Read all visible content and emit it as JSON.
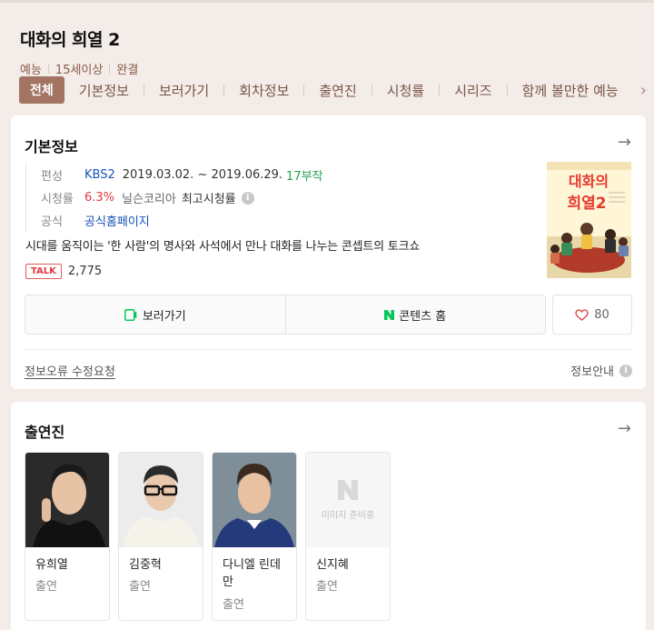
{
  "header": {
    "title": "대화의 희열 2",
    "meta": [
      "예능",
      "15세이상",
      "완결"
    ]
  },
  "tabs": [
    {
      "label": "전체",
      "active": true
    },
    {
      "label": "기본정보"
    },
    {
      "label": "보러가기"
    },
    {
      "label": "회차정보"
    },
    {
      "label": "출연진"
    },
    {
      "label": "시청률"
    },
    {
      "label": "시리즈"
    },
    {
      "label": "함께 볼만한 예능"
    }
  ],
  "basic_info": {
    "section_title": "기본정보",
    "schedule_label": "편성",
    "channel": "KBS2",
    "date_range": "2019.03.02. ~ 2019.06.29.",
    "episodes": "17부작",
    "rating_label": "시청률",
    "rating_value": "6.3%",
    "rating_source": "닐슨코리아",
    "rating_note": "최고시청률",
    "official_label": "공식",
    "official_link": "공식홈페이지",
    "description": "시대를 움직이는 '한 사람'의 명사와 사석에서 만나 대화를 나누는 콘셉트의 토크쇼",
    "talk_badge": "TALK",
    "talk_count": "2,775",
    "watch_button": "보러가기",
    "content_home_button": "콘텐츠 홈",
    "like_count": "80",
    "report_link": "정보오류 수정요청",
    "info_guide": "정보안내",
    "poster_text_line1": "대화의",
    "poster_text_line2": "희열2"
  },
  "cast": {
    "section_title": "출연진",
    "members": [
      {
        "name": "유희열",
        "role": "출연"
      },
      {
        "name": "김중혁",
        "role": "출연"
      },
      {
        "name": "다니엘 린데만",
        "role": "출연"
      },
      {
        "name": "신지혜",
        "role": "출연",
        "placeholder_text": "이미지 준비중"
      }
    ]
  },
  "colors": {
    "accent": "#a47463",
    "tab_text": "#7a5547",
    "background": "#f3ece8",
    "link_blue": "#1652b8",
    "rating_red": "#e0393f",
    "episodes_green": "#21a44b",
    "naver_green": "#03c75a"
  },
  "icons": [
    "chevron-right-icon",
    "arrow-right-icon",
    "info-icon",
    "play-tv-icon",
    "naver-n-icon",
    "heart-icon"
  ]
}
